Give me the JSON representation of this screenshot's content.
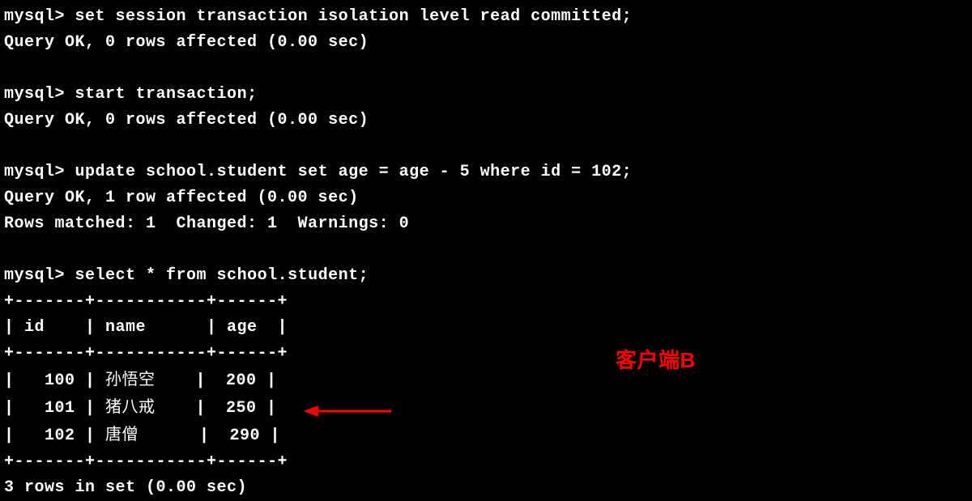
{
  "prompt": "mysql>",
  "commands": {
    "set_isolation": "set session transaction isolation level read committed;",
    "set_isolation_result": "Query OK, 0 rows affected (0.00 sec)",
    "start_transaction": "start transaction;",
    "start_transaction_result": "Query OK, 0 rows affected (0.00 sec)",
    "update": "update school.student set age = age - 5 where id = 102;",
    "update_result1": "Query OK, 1 row affected (0.00 sec)",
    "update_result2": "Rows matched: 1  Changed: 1  Warnings: 0",
    "select": "select * from school.student;",
    "select_footer": "3 rows in set (0.00 sec)"
  },
  "table": {
    "border_top": "+-------+-----------+------+",
    "header": "| id    | name      | age  |",
    "border_header": "+-------+-----------+------+",
    "row1_pre": "|   100 | ",
    "row1_name": "孙悟空",
    "row1_post": "    |  200 |",
    "row2_pre": "|   101 | ",
    "row2_name": "猪八戒",
    "row2_post": "    |  250 |",
    "row3_pre": "|   102 | ",
    "row3_name": "唐僧",
    "row3_post": "      |  290 |",
    "border_bottom": "+-------+-----------+------+"
  },
  "annotation": {
    "label": "客户端B"
  },
  "chart_data": {
    "type": "table",
    "title": "school.student",
    "columns": [
      "id",
      "name",
      "age"
    ],
    "rows": [
      {
        "id": 100,
        "name": "孙悟空",
        "age": 200
      },
      {
        "id": 101,
        "name": "猪八戒",
        "age": 250
      },
      {
        "id": 102,
        "name": "唐僧",
        "age": 290
      }
    ]
  }
}
